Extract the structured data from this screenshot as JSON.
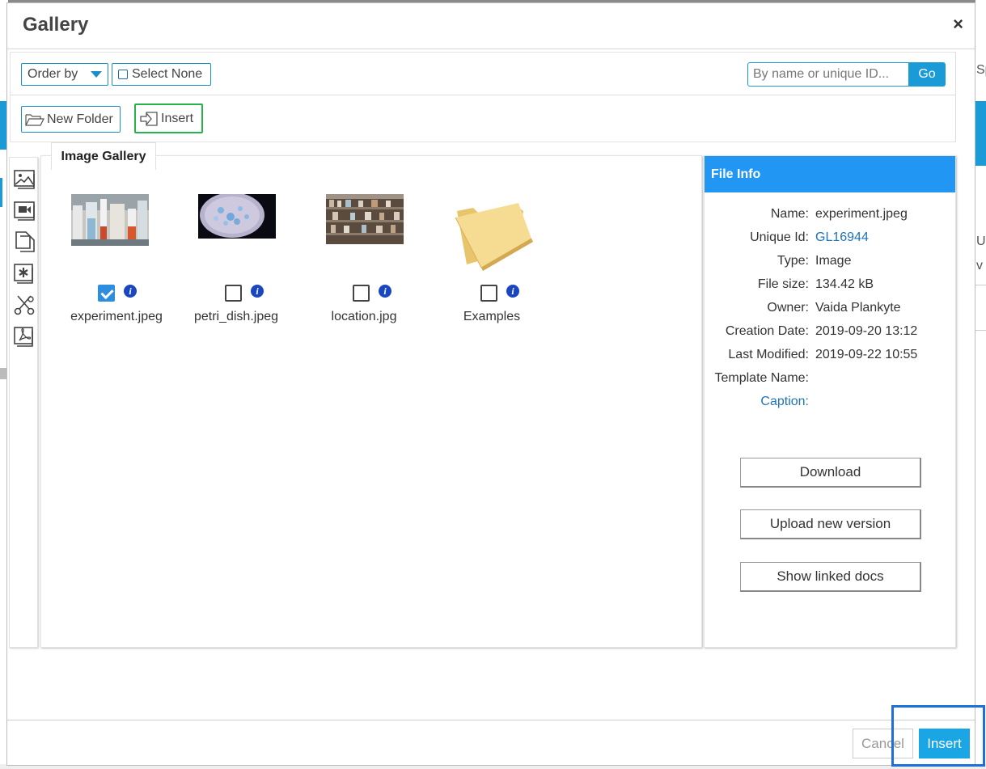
{
  "dialog": {
    "title": "Gallery",
    "close_glyph": "×"
  },
  "toolbar": {
    "order_by_label": "Order by",
    "select_none_label": "Select None",
    "search_placeholder": "By name or unique ID...",
    "go_label": "Go",
    "new_folder_label": "New Folder",
    "insert_label": "Insert"
  },
  "tab": {
    "label": "Image Gallery"
  },
  "side_tools": [
    "image-gallery-icon",
    "video-gallery-icon",
    "documents-icon",
    "chemistry-icon",
    "snippets-icon",
    "pdf-icon"
  ],
  "gallery_items": [
    {
      "label": "experiment.jpeg",
      "checked": true,
      "kind": "image",
      "icon": "lab-photo-thumbnail"
    },
    {
      "label": "petri_dish.jpeg",
      "checked": false,
      "kind": "image",
      "icon": "petri-dish-thumbnail"
    },
    {
      "label": "location.jpg",
      "checked": false,
      "kind": "image",
      "icon": "shelves-photo-thumbnail"
    },
    {
      "label": "Examples",
      "checked": false,
      "kind": "folder",
      "icon": "folder-icon"
    }
  ],
  "file_info": {
    "header": "File Info",
    "rows": [
      {
        "key": "Name:",
        "value": "experiment.jpeg"
      },
      {
        "key": "Unique Id:",
        "value": "GL16944"
      },
      {
        "key": "Type:",
        "value": "Image"
      },
      {
        "key": "File size:",
        "value": "134.42 kB"
      },
      {
        "key": "Owner:",
        "value": "Vaida Plankyte"
      },
      {
        "key": "Creation Date:",
        "value": "2019-09-20 13:12"
      },
      {
        "key": "Last Modified:",
        "value": "2019-09-22 10:55"
      },
      {
        "key": "Template Name:",
        "value": ""
      },
      {
        "key": "Caption:",
        "value": ""
      }
    ],
    "download_label": "Download",
    "upload_label": "Upload new version",
    "linked_label": "Show linked docs"
  },
  "footer": {
    "cancel_label": "Cancel",
    "insert_label": "Insert"
  },
  "background": {
    "right_text_1": "Sp",
    "right_text_2": "U",
    "right_text_3": "v"
  },
  "colors": {
    "accent": "#1a9bd7",
    "file_info_header": "#2196f3",
    "insert_highlight": "#28b24b",
    "footer_highlight": "#1e6fd9"
  }
}
